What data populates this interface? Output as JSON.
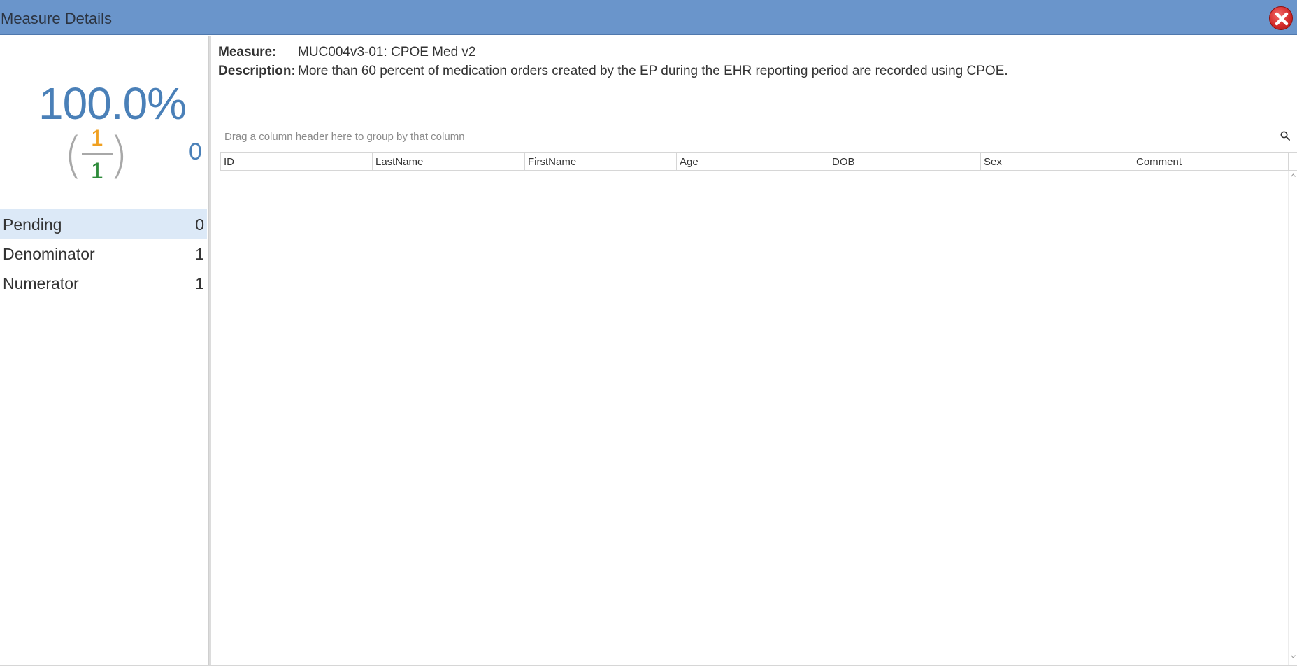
{
  "window": {
    "title": "Measure Details",
    "close_icon": "close-icon"
  },
  "summary": {
    "percent": "100.0%",
    "numerator": "1",
    "denominator": "1",
    "pending": "0",
    "colors": {
      "percent": "#4a80b8",
      "numerator": "#f0a020",
      "denominator": "#2e8b3a"
    }
  },
  "categories": [
    {
      "label": "Pending",
      "count": "0",
      "selected": true
    },
    {
      "label": "Denominator",
      "count": "1",
      "selected": false
    },
    {
      "label": "Numerator",
      "count": "1",
      "selected": false
    }
  ],
  "measure": {
    "measure_label": "Measure:",
    "measure_value": "MUC004v3-01: CPOE Med v2",
    "description_label": "Description:",
    "description_value": "More than 60 percent of medication orders created by the EP during the EHR reporting period are recorded using CPOE."
  },
  "grid": {
    "group_hint": "Drag a column header here to group by that column",
    "search_icon": "search-icon",
    "columns": [
      "ID",
      "LastName",
      "FirstName",
      "Age",
      "DOB",
      "Sex",
      "Comment"
    ],
    "rows": []
  }
}
